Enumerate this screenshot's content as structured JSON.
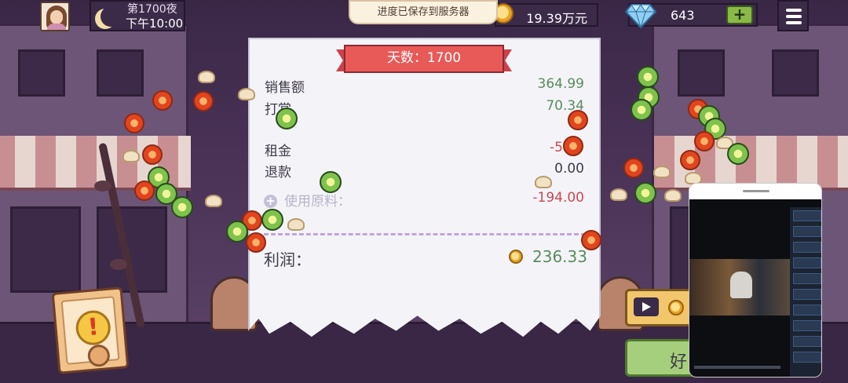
{
  "hud": {
    "night_label": "第1700夜",
    "time_label": "下午10:00",
    "toast": "进度已保存到服务器",
    "coins": "19.39万元",
    "gems": "643",
    "add_label": "+"
  },
  "receipt": {
    "day_banner": "天数：1700",
    "rows": [
      {
        "label": "销售额",
        "value": "364.99",
        "color": "#5a8b5f"
      },
      {
        "label": "打赏",
        "value": "70.34",
        "color": "#5a8b5f"
      },
      {
        "label": "租金",
        "value": "-5.00",
        "color": "#cc4652"
      },
      {
        "label": "退款",
        "value": "0.00",
        "color": "#3f3a48"
      },
      {
        "label": "使用原料：",
        "value": "-194.00",
        "color": "#cc4652"
      }
    ],
    "profit_label": "利润：",
    "profit_value": "236.33"
  },
  "buttons": {
    "ok_label": "好"
  },
  "colors": {
    "accent_green": "#5a8b5f",
    "accent_red": "#cc4652",
    "ribbon": "#e85a57"
  }
}
